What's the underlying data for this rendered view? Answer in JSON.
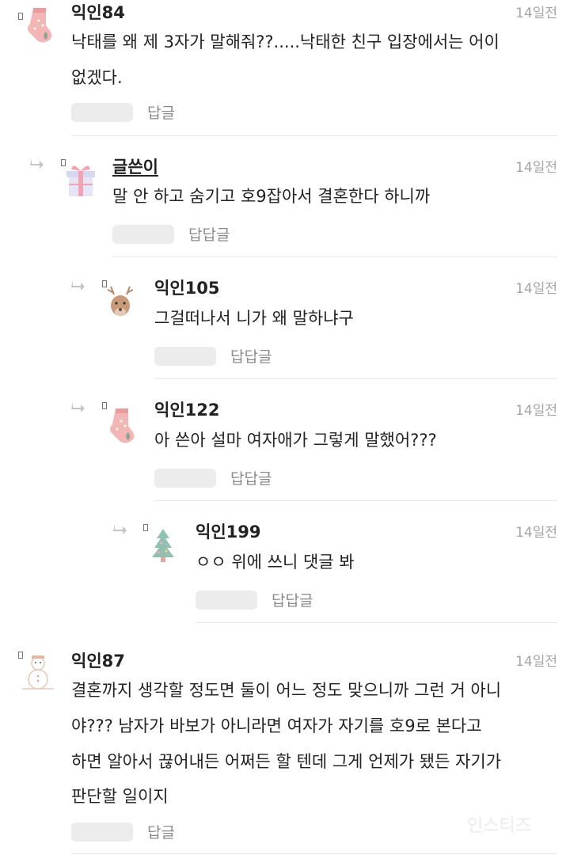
{
  "comments": [
    {
      "author": "익인84",
      "time": "14일전",
      "lines": [
        "낙태를 왜 제 3자가 말해줘??.....낙태한 친구 입장에서는 어이",
        "없겠다."
      ],
      "reply_label": "답글",
      "avatar": "sock-icon"
    },
    {
      "author": "글쓴이",
      "time": "14일전",
      "lines": [
        "말 안 하고 숨기고 호9잡아서 결혼한다 하니까"
      ],
      "reply_label": "답답글",
      "avatar": "gift-box-icon"
    },
    {
      "author": "익인105",
      "time": "14일전",
      "lines": [
        "그걸떠나서 니가 왜 말하냐구"
      ],
      "reply_label": "답답글",
      "avatar": "reindeer-icon"
    },
    {
      "author": "익인122",
      "time": "14일전",
      "lines": [
        "아 쓴아 설마 여자애가 그렇게 말했어???"
      ],
      "reply_label": "답답글",
      "avatar": "sock-icon"
    },
    {
      "author": "익인199",
      "time": "14일전",
      "lines": [
        "ㅇㅇ 위에 쓰니 댓글 봐"
      ],
      "reply_label": "답답글",
      "avatar": "christmas-tree-icon"
    },
    {
      "author": "익인87",
      "time": "14일전",
      "lines": [
        "결혼까지 생각할 정도면 둘이 어느 정도 맞으니까 그런 거 아니",
        "야??? 남자가 바보가 아니라면 여자가 자기를 호9로 본다고",
        "하면 알아서 끊어내든 어쩌든 할 텐데 그게 언제가 됐든 자기가",
        "판단할 일이지"
      ],
      "reply_label": "답글",
      "avatar": "snowman-icon"
    }
  ],
  "watermark": "인스티즈"
}
